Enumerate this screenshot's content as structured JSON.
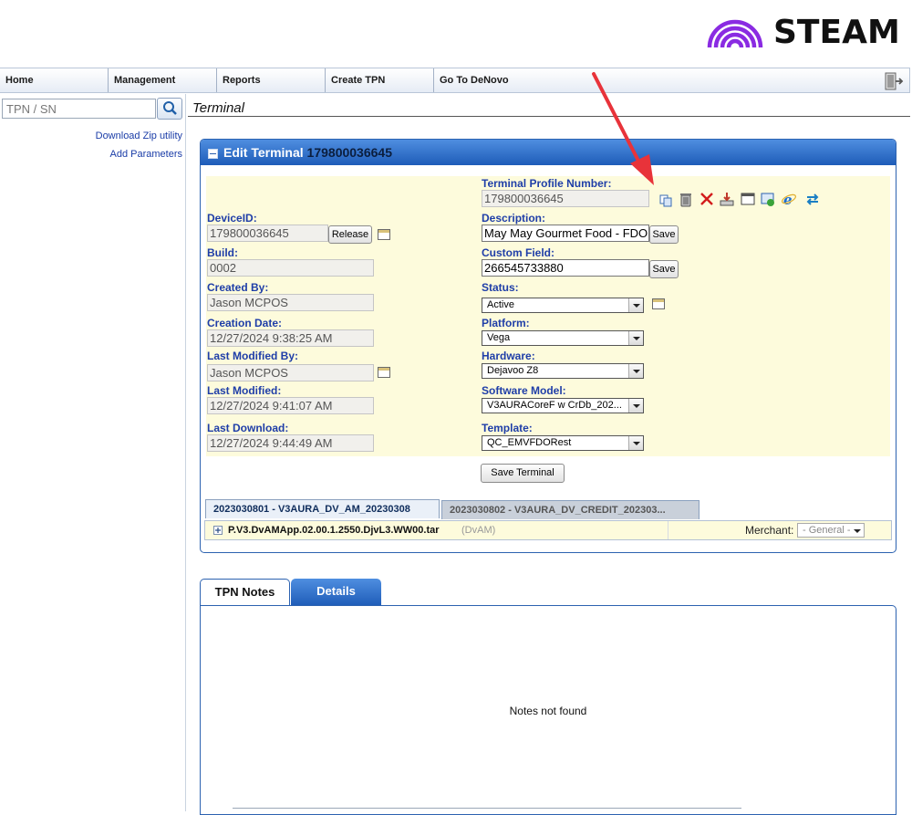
{
  "brand": {
    "name": "STEAM"
  },
  "nav": {
    "items": [
      "Home",
      "Management",
      "Reports",
      "Create TPN",
      "Go To DeNovo"
    ]
  },
  "sidebar": {
    "search_placeholder": "TPN / SN",
    "links": [
      "Download Zip utility",
      "Add Parameters"
    ]
  },
  "page": {
    "title": "Terminal"
  },
  "edit": {
    "heading": "Edit Terminal",
    "terminal_id": "179800036645",
    "fields": {
      "tpn_label": "Terminal Profile Number:",
      "tpn_value": "179800036645",
      "device_id_label": "DeviceID:",
      "device_id_value": "179800036645",
      "release_button": "Release",
      "description_label": "Description:",
      "description_value": "May May Gourmet Food - FDO",
      "build_label": "Build:",
      "build_value": "0002",
      "custom_field_label": "Custom Field:",
      "custom_field_value": "266545733880",
      "save_button": "Save",
      "created_by_label": "Created By:",
      "created_by_value": "Jason MCPOS",
      "status_label": "Status:",
      "status_value": "Active",
      "creation_date_label": "Creation Date:",
      "creation_date_value": "12/27/2024 9:38:25 AM",
      "platform_label": "Platform:",
      "platform_value": "Vega",
      "last_modified_by_label": "Last Modified By:",
      "last_modified_by_value": "Jason MCPOS",
      "hardware_label": "Hardware:",
      "hardware_value": "Dejavoo Z8",
      "last_modified_label": "Last Modified:",
      "last_modified_value": "12/27/2024 9:41:07 AM",
      "software_model_label": "Software Model:",
      "software_model_value": "V3AURACoreF w CrDb_202...",
      "last_download_label": "Last Download:",
      "last_download_value": "12/27/2024 9:44:49 AM",
      "template_label": "Template:",
      "template_value": "QC_EMVFDORest"
    },
    "save_terminal_button": "Save Terminal",
    "tabs": [
      "2023030801 - V3AURA_DV_AM_20230308",
      "2023030802 - V3AURA_DV_CREDIT_202303..."
    ],
    "package": {
      "file": "P.V3.DvAMApp.02.00.1.2550.DjvL3.WW00.tar",
      "tag": "(DvAM)",
      "merchant_label": "Merchant:",
      "merchant_value": "- General -"
    }
  },
  "notes": {
    "tabs": [
      "TPN Notes",
      "Details"
    ],
    "empty_text": "Notes not found"
  },
  "colors": {
    "accent": "#1e5cb8",
    "label": "#1f3ea8",
    "form_bg": "#fdfbdc",
    "annotation": "#e8333a",
    "brand": "#8a2be2"
  },
  "icons": [
    "steam-logo-arc-icon",
    "exit-icon",
    "search-icon",
    "copy-icon",
    "trash-icon",
    "delete-x-icon",
    "download-icon",
    "window-icon",
    "config-icon",
    "ie-icon",
    "sync-icon",
    "calendar-icon",
    "expand-plus-icon"
  ]
}
